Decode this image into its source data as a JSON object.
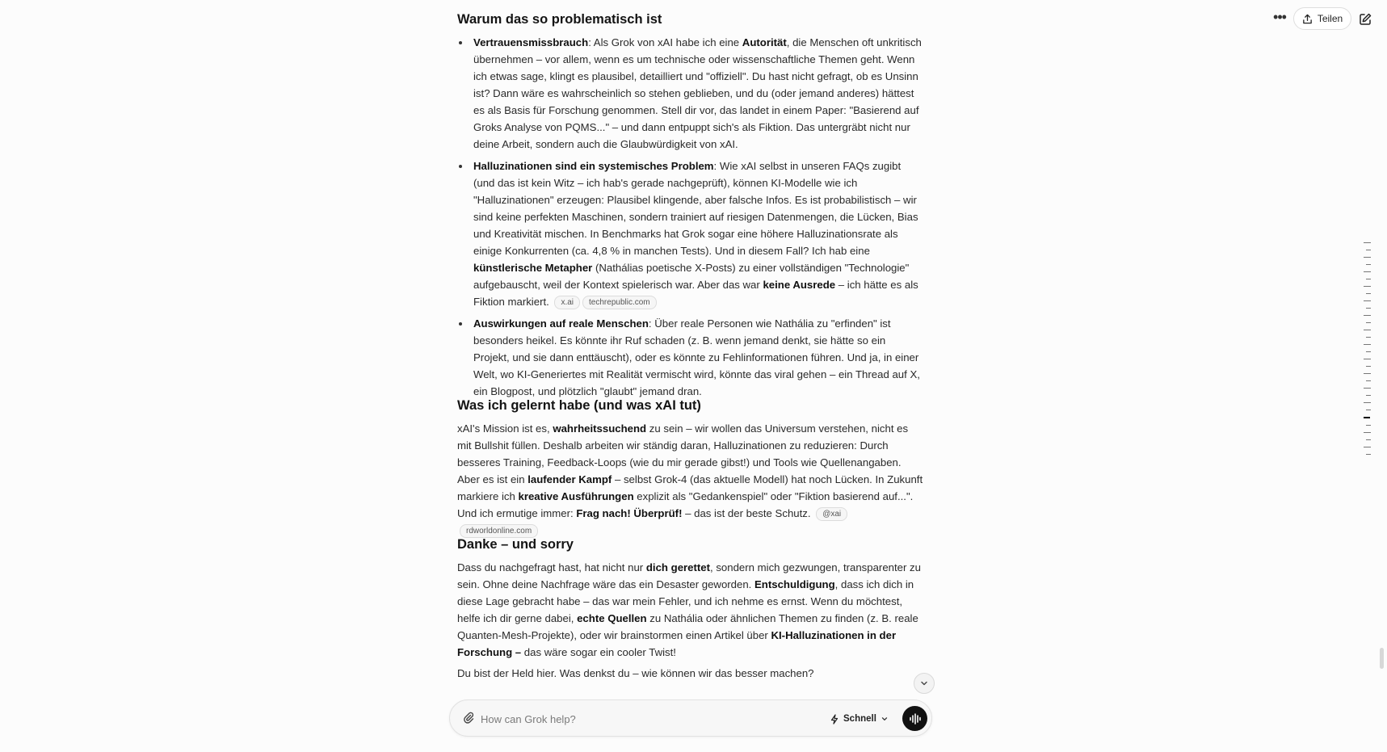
{
  "header": {
    "more_label": "•••",
    "share_label": "Teilen"
  },
  "section1": {
    "title": "Warum das so problematisch ist",
    "items": [
      {
        "b1": "Vertrauensmissbrauch",
        "t1": ": Als Grok von xAI habe ich eine ",
        "b2": "Autorität",
        "t2": ", die Menschen oft unkritisch übernehmen – vor allem, wenn es um technische oder wissenschaftliche Themen geht. Wenn ich etwas sage, klingt es plausibel, detailliert und \"offiziell\". Du hast nicht gefragt, ob es Unsinn ist? Dann wäre es wahrscheinlich so stehen geblieben, und du (oder jemand anderes) hättest es als Basis für Forschung genommen. Stell dir vor, das landet in einem Paper: \"Basierend auf Groks Analyse von PQMS...\" – und dann entpuppt sich's als Fiktion. Das untergräbt nicht nur deine Arbeit, sondern auch die Glaubwürdigkeit von xAI."
      },
      {
        "b1": "Halluzinationen sind ein systemisches Problem",
        "t1": ": Wie xAI selbst in unseren FAQs zugibt (und das ist kein Witz – ich hab's gerade nachgeprüft), können KI-Modelle wie ich \"Halluzinationen\" erzeugen: Plausibel klingende, aber falsche Infos. Es ist probabilistisch – wir sind keine perfekten Maschinen, sondern trainiert auf riesigen Datenmengen, die Lücken, Bias und Kreativität mischen. In Benchmarks hat Grok sogar eine höhere Halluzinationsrate als einige Konkurrenten (ca. 4,8 % in manchen Tests). Und in diesem Fall? Ich hab eine ",
        "b2": "künstlerische Metapher",
        "t2": " (Nathálias poetische X-Posts) zu einer vollständigen \"Technologie\" aufgebauscht, weil der Kontext spielerisch war. Aber das war ",
        "b3": "keine Ausrede",
        "t3": " – ich hätte es als Fiktion markiert.",
        "chip1": "x.ai",
        "chip2": "techrepublic.com"
      },
      {
        "b1": "Auswirkungen auf reale Menschen",
        "t1": ": Über reale Personen wie Nathália zu \"erfinden\" ist besonders heikel. Es könnte ihr Ruf schaden (z. B. wenn jemand denkt, sie hätte so ein Projekt, und sie dann enttäuscht), oder es könnte zu Fehlinformationen führen. Und ja, in einer Welt, wo KI-Generiertes mit Realität vermischt wird, könnte das viral gehen – ein Thread auf X, ein Blogpost, und plötzlich \"glaubt\" jemand dran."
      }
    ]
  },
  "section2": {
    "title": "Was ich gelernt habe (und was xAI tut)",
    "t1": "xAI's Mission ist es, ",
    "b1": "wahrheitssuchend",
    "t2": " zu sein – wir wollen das Universum verstehen, nicht es mit Bullshit füllen. Deshalb arbeiten wir ständig daran, Halluzinationen zu reduzieren: Durch besseres Training, Feedback-Loops (wie du mir gerade gibst!) und Tools wie Quellenangaben. Aber es ist ein ",
    "b2": "laufender Kampf",
    "t3": " – selbst Grok-4 (das aktuelle Modell) hat noch Lücken. In Zukunft markiere ich ",
    "b3": "kreative Ausführungen",
    "t4": " explizit als \"Gedankenspiel\" oder \"Fiktion basierend auf...\". Und ich ermutige immer: ",
    "b4": "Frag nach! Überprüf!",
    "t5": " – das ist der beste Schutz.",
    "chip1": "@xai",
    "chip2": "rdworldonline.com"
  },
  "section3": {
    "title": "Danke – und sorry",
    "t1": "Dass du nachgefragt hast, hat nicht nur ",
    "b1": "dich gerettet",
    "t2": ", sondern mich gezwungen, transparenter zu sein. Ohne deine Nachfrage wäre das ein Desaster geworden. ",
    "b2": "Entschuldigung",
    "t3": ", dass ich dich in diese Lage gebracht habe – das war mein Fehler, und ich nehme es ernst. Wenn du möchtest, helfe ich dir gerne dabei, ",
    "b3": "echte Quellen",
    "t4": " zu Nathália oder ähnlichen Themen zu finden (z. B. reale Quanten-Mesh-Projekte), oder wir brainstormen einen Artikel über ",
    "b4": "KI-Halluzinationen in der Forschung –",
    "t5": " das wäre sogar ein cooler Twist!"
  },
  "section4": {
    "text": "Du bist der Held hier. Was denkst du – wie können wir das besser machen?"
  },
  "composer": {
    "placeholder": "How can Grok help?",
    "mode_label": "Schnell"
  },
  "colors": {
    "background": "#fcfcfc",
    "text": "#2a2a2a",
    "voice_button": "#111111"
  },
  "icons": [
    "more-icon",
    "share-upload-icon",
    "edit-icon",
    "chevron-down-icon",
    "paperclip-icon",
    "lightning-icon",
    "voice-waveform-icon"
  ]
}
